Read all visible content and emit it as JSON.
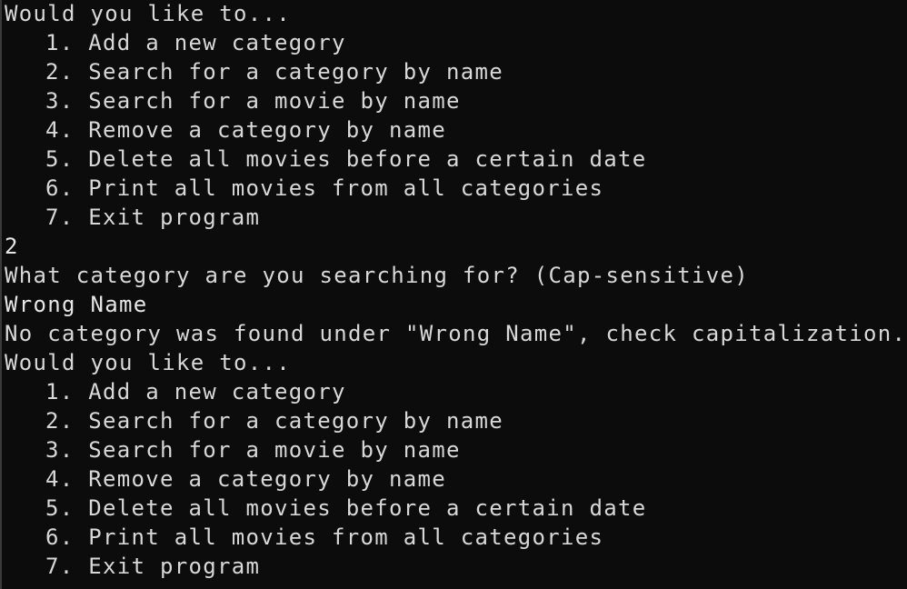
{
  "console": {
    "lines": [
      {
        "text": "Would you like to...",
        "kind": "prompt"
      },
      {
        "text": "1. Add a new category",
        "kind": "menu"
      },
      {
        "text": "2. Search for a category by name",
        "kind": "menu"
      },
      {
        "text": "3. Search for a movie by name",
        "kind": "menu"
      },
      {
        "text": "4. Remove a category by name",
        "kind": "menu"
      },
      {
        "text": "5. Delete all movies before a certain date",
        "kind": "menu"
      },
      {
        "text": "6. Print all movies from all categories",
        "kind": "menu"
      },
      {
        "text": "7. Exit program",
        "kind": "menu"
      },
      {
        "text": "2",
        "kind": "input"
      },
      {
        "text": "What category are you searching for? (Cap-sensitive)",
        "kind": "prompt"
      },
      {
        "text": "Wrong Name",
        "kind": "input"
      },
      {
        "text": "No category was found under \"Wrong Name\", check capitalization...",
        "kind": "output"
      },
      {
        "text": "Would you like to...",
        "kind": "prompt"
      },
      {
        "text": "1. Add a new category",
        "kind": "menu"
      },
      {
        "text": "2. Search for a category by name",
        "kind": "menu"
      },
      {
        "text": "3. Search for a movie by name",
        "kind": "menu"
      },
      {
        "text": "4. Remove a category by name",
        "kind": "menu"
      },
      {
        "text": "5. Delete all movies before a certain date",
        "kind": "menu"
      },
      {
        "text": "6. Print all movies from all categories",
        "kind": "menu"
      },
      {
        "text": "7. Exit program",
        "kind": "menu"
      }
    ]
  }
}
